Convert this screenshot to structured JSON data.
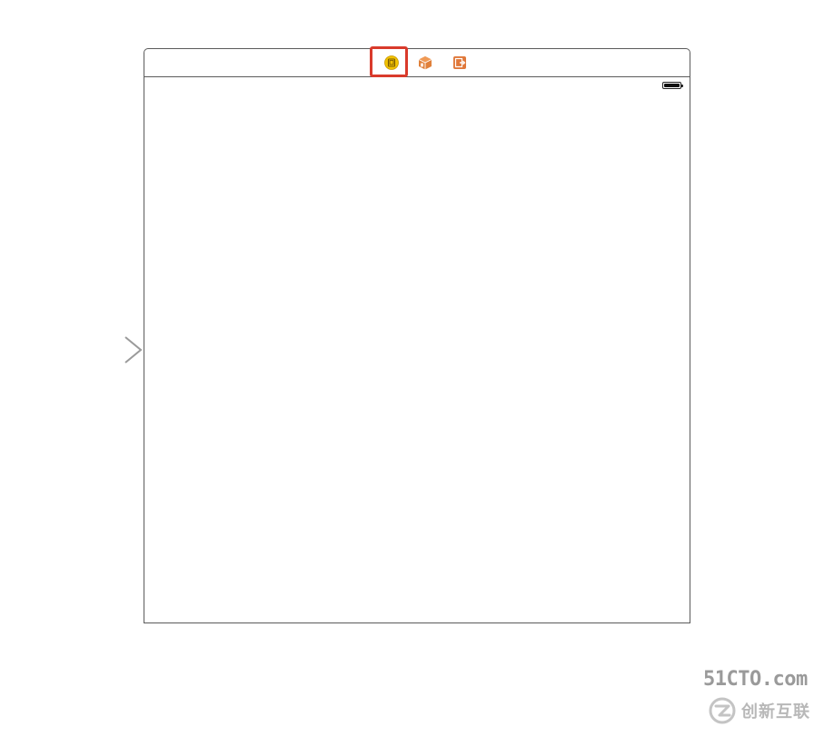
{
  "storyboard": {
    "scene_dock": {
      "icons": [
        {
          "name": "view-controller-icon",
          "color": "#e6b400",
          "highlighted": true
        },
        {
          "name": "first-responder-icon",
          "color": "#d9792b",
          "highlighted": false
        },
        {
          "name": "exit-icon",
          "color": "#d9792b",
          "highlighted": false
        }
      ],
      "highlight_color": "#d93a2b"
    },
    "status_bar": {
      "battery_icon": "battery-icon"
    },
    "entry_point": {
      "icon": "entry-arrow-icon",
      "color": "#a0a0a0"
    }
  },
  "watermark": {
    "site": "51CTO.com",
    "logo_text": "创新互联"
  }
}
